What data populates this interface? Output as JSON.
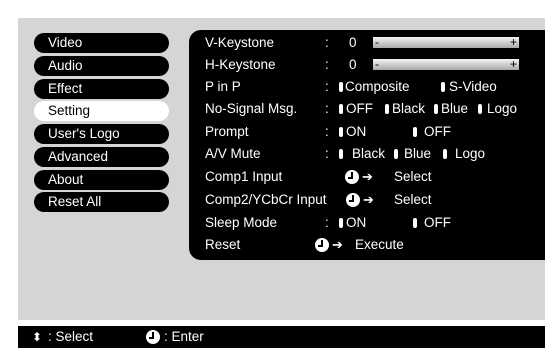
{
  "menu": {
    "left_items": [
      {
        "label": "Video"
      },
      {
        "label": "Audio"
      },
      {
        "label": "Effect"
      },
      {
        "label": "Setting"
      },
      {
        "label": "User's Logo"
      },
      {
        "label": "Advanced"
      },
      {
        "label": "About"
      },
      {
        "label": "Reset All"
      }
    ],
    "selected_item": "Setting"
  },
  "settings": {
    "v_keystone": {
      "label": "V-Keystone",
      "colon": ":",
      "value": "0",
      "minus": "-",
      "plus": "+"
    },
    "h_keystone": {
      "label": "H-Keystone",
      "colon": ":",
      "value": "0",
      "minus": "-",
      "plus": "+"
    },
    "p_in_p": {
      "label": "P in P",
      "colon": ":",
      "options": [
        "Composite",
        "S-Video"
      ]
    },
    "no_signal": {
      "label": "No-Signal Msg.",
      "colon": ":",
      "options": [
        "OFF",
        "Black",
        "Blue",
        "Logo"
      ]
    },
    "prompt": {
      "label": "Prompt",
      "colon": ":",
      "options": [
        "ON",
        "OFF"
      ]
    },
    "av_mute": {
      "label": "A/V Mute",
      "colon": ":",
      "options": [
        "Black",
        "Blue",
        "Logo"
      ]
    },
    "comp1_input": {
      "label": "Comp1 Input",
      "action": "Select"
    },
    "comp2_input": {
      "label": "Comp2/YCbCr Input",
      "action": "Select"
    },
    "sleep_mode": {
      "label": "Sleep Mode",
      "colon": ":",
      "options": [
        "ON",
        "OFF"
      ]
    },
    "reset": {
      "label": "Reset",
      "action": "Execute"
    }
  },
  "footer": {
    "select_label": ": Select",
    "enter_label": ": Enter"
  },
  "colors": {
    "background": "#d5d5d5",
    "item_bg": "#000000",
    "item_text": "#ffffff",
    "selected_bg": "#ffffff",
    "selected_text": "#000000"
  }
}
